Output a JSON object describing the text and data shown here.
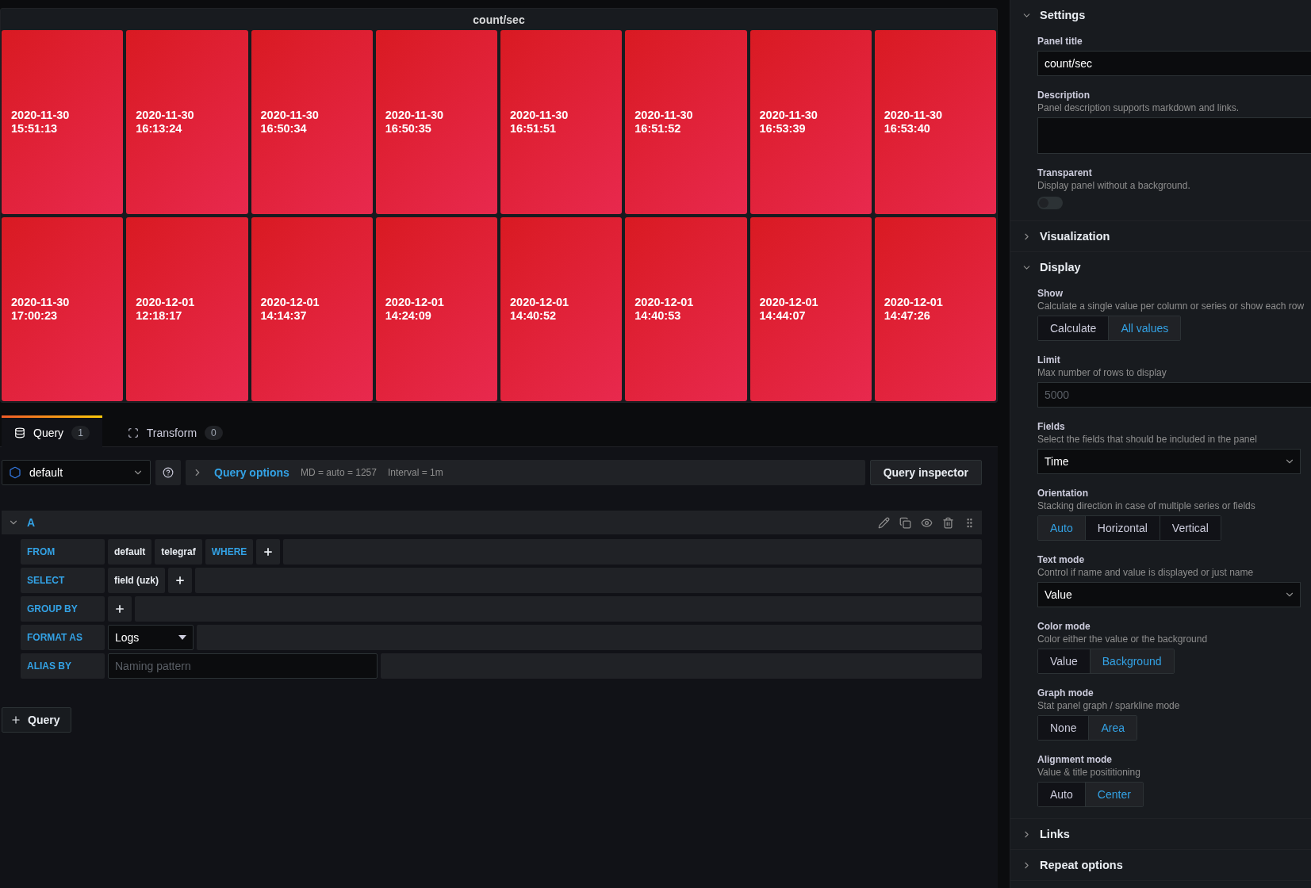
{
  "panel": {
    "title": "count/sec",
    "tiles": [
      {
        "date": "2020-11-30",
        "time": "15:51:13"
      },
      {
        "date": "2020-11-30",
        "time": "16:13:24"
      },
      {
        "date": "2020-11-30",
        "time": "16:50:34"
      },
      {
        "date": "2020-11-30",
        "time": "16:50:35"
      },
      {
        "date": "2020-11-30",
        "time": "16:51:51"
      },
      {
        "date": "2020-11-30",
        "time": "16:51:52"
      },
      {
        "date": "2020-11-30",
        "time": "16:53:39"
      },
      {
        "date": "2020-11-30",
        "time": "16:53:40"
      },
      {
        "date": "2020-11-30",
        "time": "17:00:23"
      },
      {
        "date": "2020-12-01",
        "time": "12:18:17"
      },
      {
        "date": "2020-12-01",
        "time": "14:14:37"
      },
      {
        "date": "2020-12-01",
        "time": "14:24:09"
      },
      {
        "date": "2020-12-01",
        "time": "14:40:52"
      },
      {
        "date": "2020-12-01",
        "time": "14:40:53"
      },
      {
        "date": "2020-12-01",
        "time": "14:44:07"
      },
      {
        "date": "2020-12-01",
        "time": "14:47:26"
      }
    ]
  },
  "tabs": [
    {
      "label": "Query",
      "count": "1",
      "selected": true,
      "kind": "query"
    },
    {
      "label": "Transform",
      "count": "0",
      "selected": false,
      "kind": "transform"
    }
  ],
  "datasource": {
    "value": "default"
  },
  "query_options": {
    "label": "Query options",
    "max_data_points": "MD = auto = 1257",
    "interval": "Interval = 1m"
  },
  "query_inspector": "Query inspector",
  "query": {
    "ref_id": "A",
    "expanded": true,
    "rows": [
      {
        "label": "FROM",
        "kind": "segments",
        "segments": [
          {
            "kind": "value",
            "text": "default"
          },
          {
            "kind": "value",
            "text": "telegraf"
          },
          {
            "kind": "keyword",
            "text": "WHERE"
          },
          {
            "kind": "add"
          }
        ]
      },
      {
        "label": "SELECT",
        "kind": "segments",
        "segments": [
          {
            "kind": "value",
            "text": "field (uzk)"
          },
          {
            "kind": "add"
          }
        ]
      },
      {
        "label": "GROUP BY",
        "kind": "segments",
        "segments": [
          {
            "kind": "add"
          }
        ]
      },
      {
        "label": "FORMAT AS",
        "kind": "select",
        "value": "Logs"
      },
      {
        "label": "ALIAS BY",
        "kind": "input",
        "placeholder": "Naming pattern"
      }
    ]
  },
  "add_query": "Query",
  "options": {
    "sections": [
      {
        "title": "Settings",
        "expanded": true,
        "fields": [
          {
            "kind": "input",
            "label": "Panel title",
            "value": "count/sec"
          },
          {
            "kind": "textarea",
            "label": "Description",
            "description": "Panel description supports markdown and links."
          },
          {
            "kind": "switch",
            "label": "Transparent",
            "description": "Display panel without a background.",
            "on": false
          }
        ]
      },
      {
        "title": "Visualization",
        "expanded": false
      },
      {
        "title": "Display",
        "expanded": true,
        "fields": [
          {
            "kind": "radio",
            "label": "Show",
            "description": "Calculate a single value per column or series or show each row",
            "options": [
              {
                "label": "Calculate",
                "selected": false
              },
              {
                "label": "All values",
                "selected": true
              }
            ]
          },
          {
            "kind": "input",
            "label": "Limit",
            "description": "Max number of rows to display",
            "placeholder": "5000"
          },
          {
            "kind": "select",
            "label": "Fields",
            "description": "Select the fields that should be included in the panel",
            "value": "Time"
          },
          {
            "kind": "radio",
            "label": "Orientation",
            "description": "Stacking direction in case of multiple series or fields",
            "options": [
              {
                "label": "Auto",
                "selected": true
              },
              {
                "label": "Horizontal",
                "selected": false
              },
              {
                "label": "Vertical",
                "selected": false
              }
            ]
          },
          {
            "kind": "select",
            "label": "Text mode",
            "description": "Control if name and value is displayed or just name",
            "value": "Value"
          },
          {
            "kind": "radio",
            "label": "Color mode",
            "description": "Color either the value or the background",
            "options": [
              {
                "label": "Value",
                "selected": false
              },
              {
                "label": "Background",
                "selected": true
              }
            ]
          },
          {
            "kind": "radio",
            "label": "Graph mode",
            "description": "Stat panel graph / sparkline mode",
            "options": [
              {
                "label": "None",
                "selected": false
              },
              {
                "label": "Area",
                "selected": true
              }
            ]
          },
          {
            "kind": "radio",
            "label": "Alignment mode",
            "description": "Value & title posititioning",
            "options": [
              {
                "label": "Auto",
                "selected": false
              },
              {
                "label": "Center",
                "selected": true
              }
            ]
          }
        ]
      },
      {
        "title": "Links",
        "expanded": false
      },
      {
        "title": "Repeat options",
        "expanded": false
      }
    ]
  }
}
